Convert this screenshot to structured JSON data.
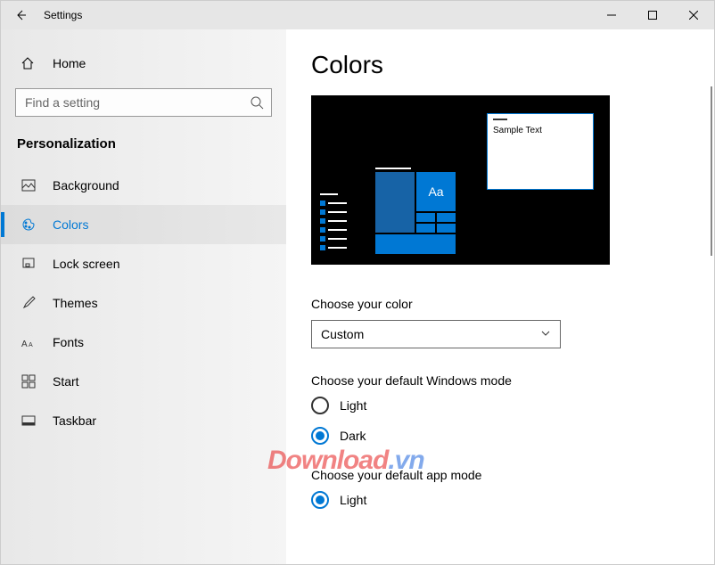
{
  "titlebar": {
    "app_name": "Settings"
  },
  "sidebar": {
    "home_label": "Home",
    "search_placeholder": "Find a setting",
    "category": "Personalization",
    "items": [
      {
        "label": "Background"
      },
      {
        "label": "Colors"
      },
      {
        "label": "Lock screen"
      },
      {
        "label": "Themes"
      },
      {
        "label": "Fonts"
      },
      {
        "label": "Start"
      },
      {
        "label": "Taskbar"
      }
    ]
  },
  "main": {
    "heading": "Colors",
    "preview_sample": "Sample Text",
    "preview_aa": "Aa",
    "color_section_label": "Choose your color",
    "color_select_value": "Custom",
    "windows_mode_label": "Choose your default Windows mode",
    "windows_mode_options": {
      "light": "Light",
      "dark": "Dark"
    },
    "app_mode_label": "Choose your default app mode",
    "app_mode_options": {
      "light": "Light"
    }
  },
  "watermark": {
    "brand": "Download",
    "suffix": ".vn"
  }
}
